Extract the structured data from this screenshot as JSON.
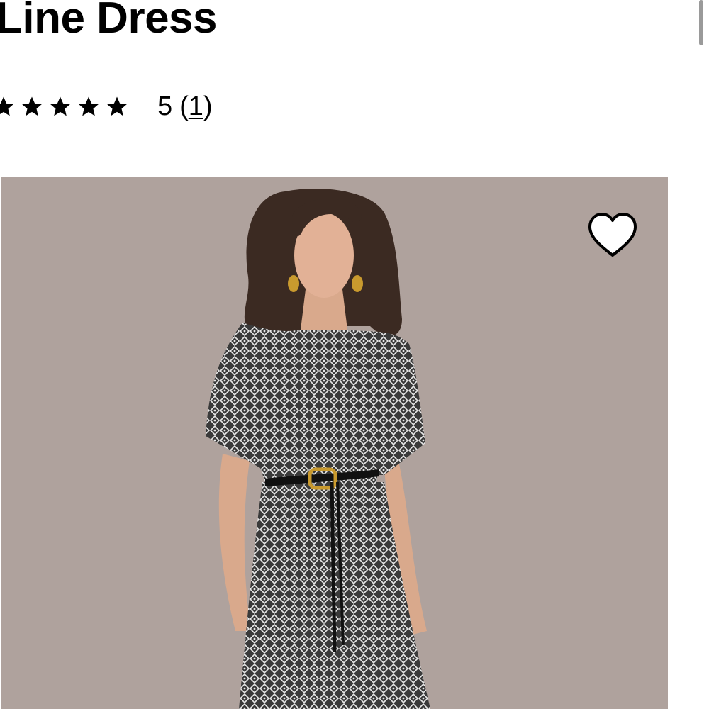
{
  "product": {
    "title": "Line Dress",
    "rating": {
      "stars_filled": 5,
      "stars_total": 5,
      "value": "5",
      "count_open": "(",
      "count": "1",
      "count_close": ")"
    }
  },
  "gallery": {
    "background_color": "#afa29d",
    "wishlist_icon": "heart-outline-icon"
  },
  "icons": {
    "star": "star-icon",
    "heart": "heart-icon"
  }
}
